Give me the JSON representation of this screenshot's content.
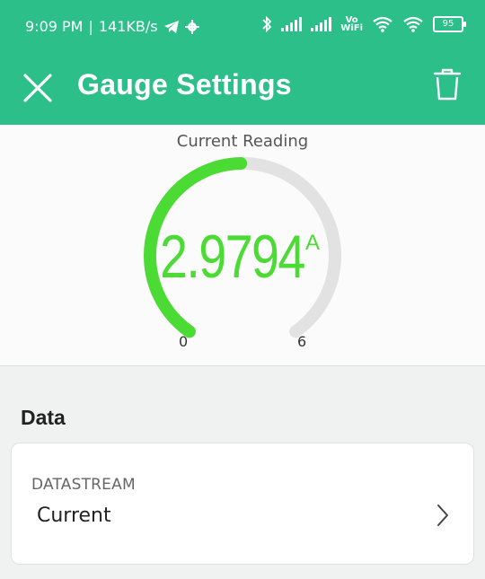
{
  "status_bar": {
    "time": "9:09 PM",
    "separator": "|",
    "speed": "141KB/s",
    "vowifi_line1": "Vo",
    "vowifi_line2": "WiFi",
    "battery": "95"
  },
  "toolbar": {
    "title": "Gauge Settings",
    "close_icon": "close-icon",
    "trash_icon": "trash-icon"
  },
  "gauge": {
    "label": "Current Reading",
    "value": "2.9794",
    "unit": "A",
    "min": "0",
    "max": "6",
    "min_value": 0,
    "max_value": 6,
    "current_value": 2.9794,
    "fill_color": "#4cdb35",
    "track_color": "#e2e2e2"
  },
  "data_section": {
    "title": "Data",
    "datastream_label": "DATASTREAM",
    "datastream_value": "Current"
  },
  "colors": {
    "header": "#2dbf8a",
    "accent_green": "#4cdb35"
  }
}
